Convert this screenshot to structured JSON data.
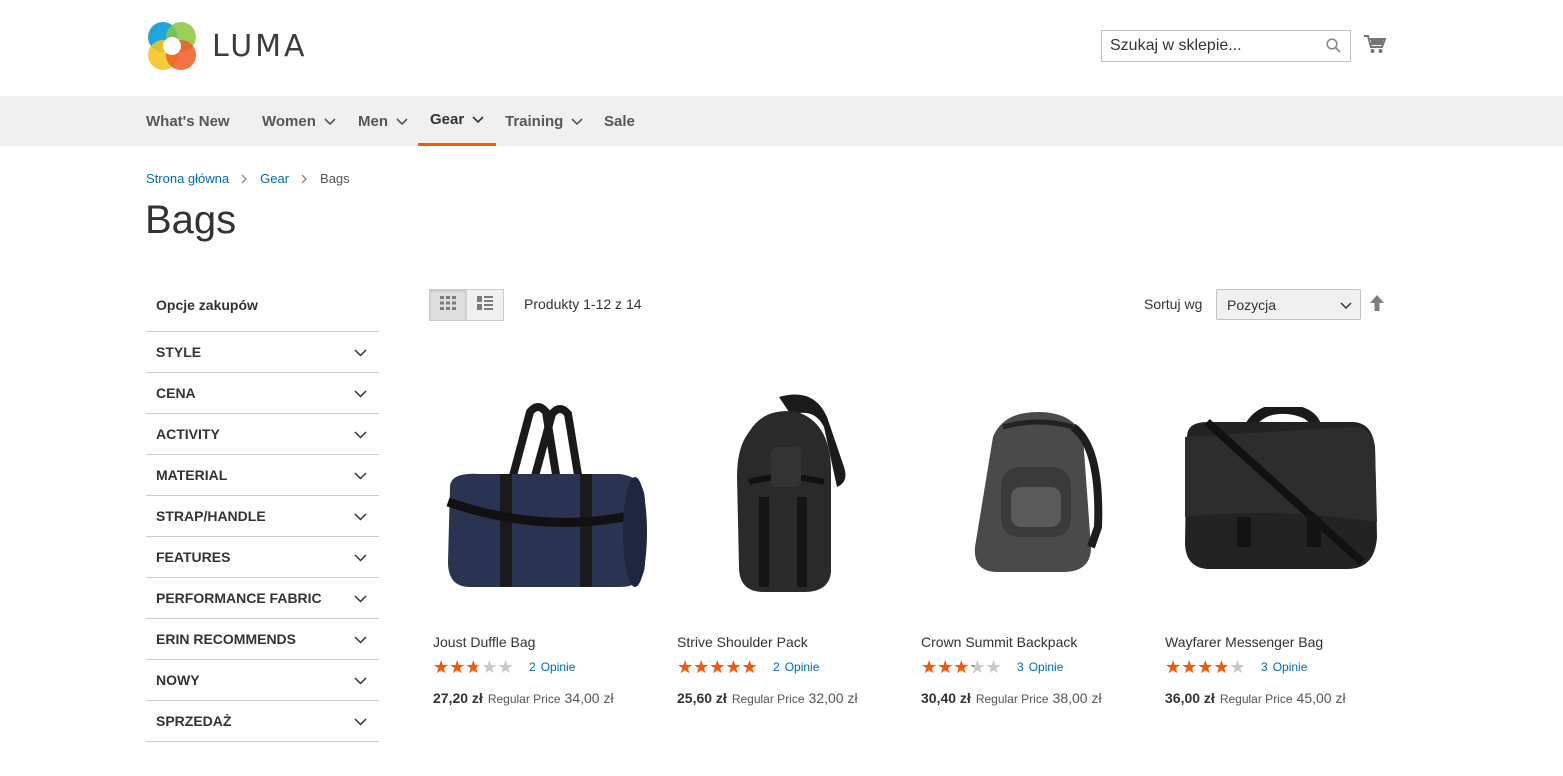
{
  "header": {
    "logo_text": "LUMA",
    "search_placeholder": "Szukaj w sklepie...",
    "colors": {
      "accent": "#ff5501",
      "link": "#006bb4"
    }
  },
  "nav": {
    "items": [
      {
        "label": "What's New",
        "has_dropdown": false
      },
      {
        "label": "Women",
        "has_dropdown": true
      },
      {
        "label": "Men",
        "has_dropdown": true
      },
      {
        "label": "Gear",
        "has_dropdown": true,
        "active": true
      },
      {
        "label": "Training",
        "has_dropdown": true
      },
      {
        "label": "Sale",
        "has_dropdown": false
      }
    ]
  },
  "breadcrumb": {
    "items": [
      "Strona główna",
      "Gear"
    ],
    "current": "Bags"
  },
  "page_title": "Bags",
  "sidebar": {
    "title": "Opcje zakupów",
    "filters": [
      "STYLE",
      "CENA",
      "ACTIVITY",
      "MATERIAL",
      "STRAP/HANDLE",
      "FEATURES",
      "PERFORMANCE FABRIC",
      "ERIN RECOMMENDS",
      "NOWY",
      "SPRZEDAŻ"
    ]
  },
  "toolbar": {
    "amount": "Produkty 1-12 z 14",
    "sort_label": "Sortuj wg",
    "sort_value": "Pozycja",
    "view_mode": "grid"
  },
  "products": [
    {
      "name": "Joust Duffle Bag",
      "rating_percent": 50,
      "review_count": "2",
      "reviews_label": "Opinie",
      "special_price": "27,20 zł",
      "regular_label": "Regular Price",
      "regular_price": "34,00 zł",
      "image_icon": "duffle-bag-icon"
    },
    {
      "name": "Strive Shoulder Pack",
      "rating_percent": 90,
      "review_count": "2",
      "reviews_label": "Opinie",
      "special_price": "25,60 zł",
      "regular_label": "Regular Price",
      "regular_price": "32,00 zł",
      "image_icon": "shoulder-pack-icon"
    },
    {
      "name": "Crown Summit Backpack",
      "rating_percent": 60,
      "review_count": "3",
      "reviews_label": "Opinie",
      "special_price": "30,40 zł",
      "regular_label": "Regular Price",
      "regular_price": "38,00 zł",
      "image_icon": "backpack-icon"
    },
    {
      "name": "Wayfarer Messenger Bag",
      "rating_percent": 70,
      "review_count": "3",
      "reviews_label": "Opinie",
      "special_price": "36,00 zł",
      "regular_label": "Regular Price",
      "regular_price": "45,00 zł",
      "image_icon": "messenger-bag-icon"
    }
  ]
}
